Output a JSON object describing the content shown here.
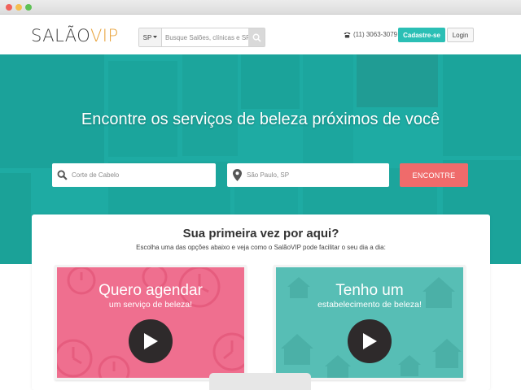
{
  "header": {
    "logo": {
      "main": "SALÃO",
      "accent": "VIP"
    },
    "state_select": "SP",
    "search_placeholder": "Busque Salões, clínicas e SPAs",
    "phone": "(11) 3063-3079",
    "signup_label": "Cadastre-se",
    "login_label": "Login"
  },
  "hero": {
    "title": "Encontre os serviços de beleza próximos de você",
    "service_placeholder": "Corte de Cabelo",
    "location_placeholder": "São Paulo, SP",
    "find_label": "ENCONTRE"
  },
  "intro": {
    "title": "Sua primeira vez por aqui?",
    "subtitle": "Escolha uma das opções abaixo e veja como o SalãoVIP pode facilitar o seu dia a dia:"
  },
  "cards": [
    {
      "title": "Quero agendar",
      "subtitle": "um serviço de beleza!"
    },
    {
      "title": "Tenho um",
      "subtitle": "estabelecimento de beleza!"
    }
  ],
  "colors": {
    "accent": "#2bbfb5",
    "find_button": "#ef6b6b",
    "pink_card": "#ef6f8f",
    "teal_card": "#57beb5",
    "logo_accent": "#e8a23a"
  },
  "icons": [
    "search-icon",
    "map-pin-icon",
    "phone-icon",
    "caret-down-icon",
    "play-icon",
    "clock-icon",
    "house-icon"
  ]
}
